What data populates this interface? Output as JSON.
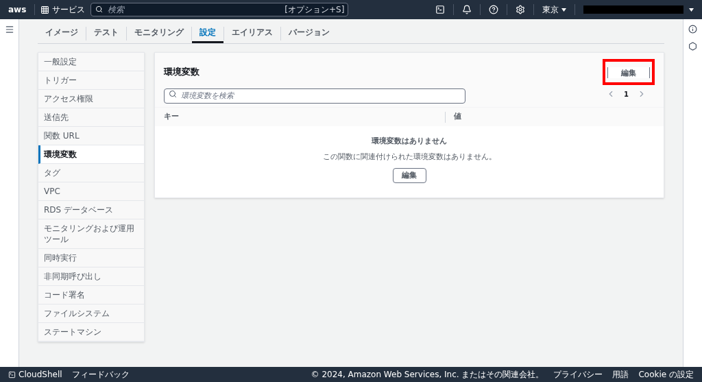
{
  "top_bar": {
    "logo": "aws",
    "services": "サービス",
    "search": {
      "placeholder": "検索",
      "shortcut": "[オプション+S]"
    },
    "region": "東京",
    "account_redacted": true
  },
  "tabs": [
    {
      "label": "イメージ",
      "selected": false
    },
    {
      "label": "テスト",
      "selected": false
    },
    {
      "label": "モニタリング",
      "selected": false
    },
    {
      "label": "設定",
      "selected": true
    },
    {
      "label": "エイリアス",
      "selected": false
    },
    {
      "label": "バージョン",
      "selected": false
    }
  ],
  "sidebar": {
    "items": [
      {
        "label": "一般設定",
        "selected": false
      },
      {
        "label": "トリガー",
        "selected": false
      },
      {
        "label": "アクセス権限",
        "selected": false
      },
      {
        "label": "送信先",
        "selected": false
      },
      {
        "label": "関数 URL",
        "selected": false
      },
      {
        "label": "環境変数",
        "selected": true
      },
      {
        "label": "タグ",
        "selected": false
      },
      {
        "label": "VPC",
        "selected": false
      },
      {
        "label": "RDS データベース",
        "selected": false
      },
      {
        "label": "モニタリングおよび運用ツール",
        "selected": false
      },
      {
        "label": "同時実行",
        "selected": false
      },
      {
        "label": "非同期呼び出し",
        "selected": false
      },
      {
        "label": "コード署名",
        "selected": false
      },
      {
        "label": "ファイルシステム",
        "selected": false
      },
      {
        "label": "ステートマシン",
        "selected": false
      }
    ]
  },
  "panel": {
    "title": "環境変数",
    "edit_button": {
      "label": "編集",
      "highlighted": true
    },
    "search": {
      "placeholder": "環境変数を検索"
    },
    "pagination": {
      "page": "1"
    },
    "table": {
      "columns": [
        "キー",
        "値"
      ]
    },
    "empty": {
      "title": "環境変数はありません",
      "message": "この関数に関連付けられた環境変数はありません。",
      "button": "編集"
    }
  },
  "footer": {
    "left": [
      "CloudShell",
      "フィードバック"
    ],
    "right": [
      "© 2024, Amazon Web Services, Inc. またはその関連会社。",
      "プライバシー",
      "用語",
      "Cookie の設定"
    ]
  }
}
